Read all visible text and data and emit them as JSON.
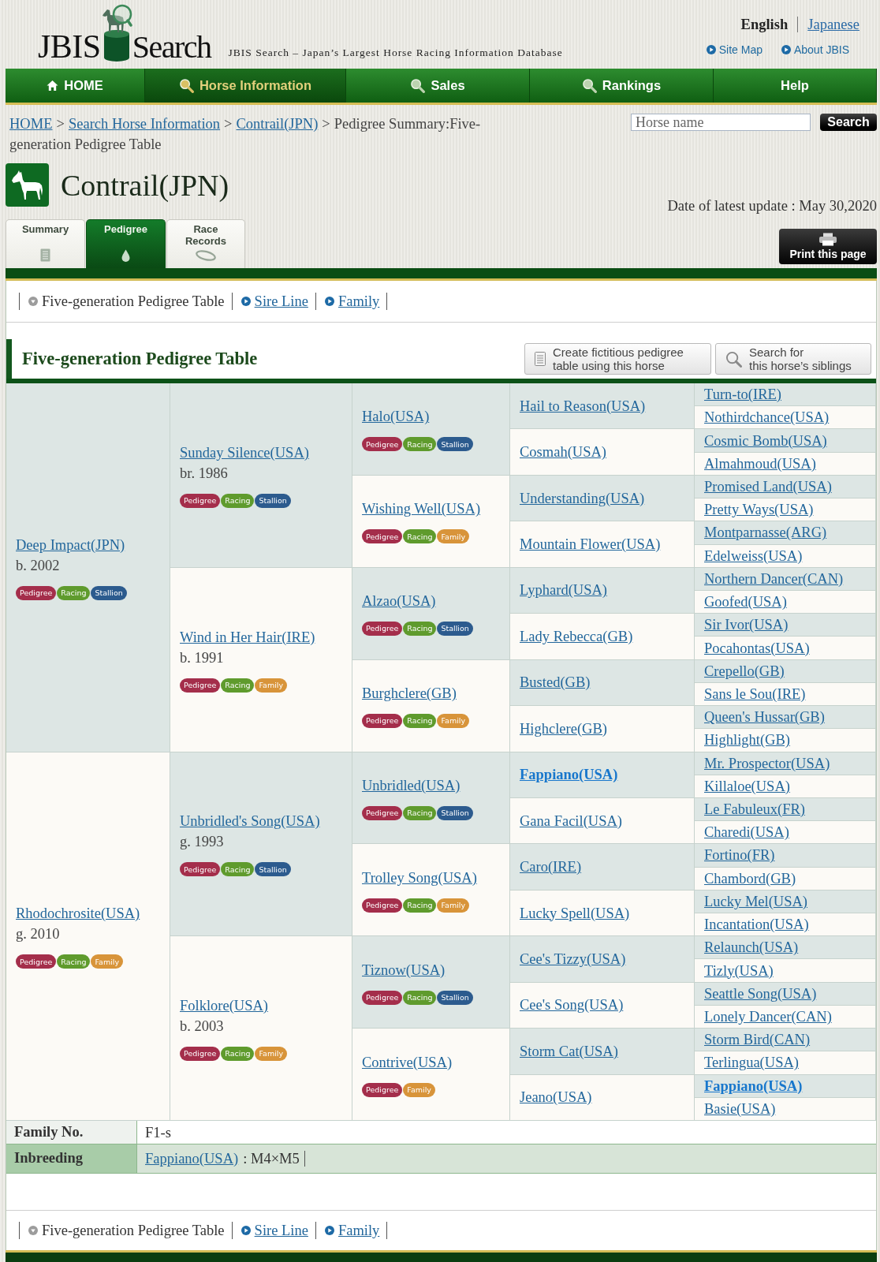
{
  "header": {
    "logo": {
      "before": "JBIS",
      "after": "Search"
    },
    "tagline": "JBIS Search – Japan’s Largest Horse Racing Information Database",
    "languages": [
      {
        "label": "English",
        "selected": true
      },
      {
        "label": "Japanese",
        "selected": false
      }
    ],
    "links": [
      "Site Map",
      "About JBIS"
    ]
  },
  "nav": [
    {
      "label": "HOME",
      "kind": "home",
      "selected": false
    },
    {
      "label": "Horse Information",
      "kind": "search",
      "selected": true
    },
    {
      "label": "Sales",
      "kind": "search",
      "selected": false
    },
    {
      "label": "Rankings",
      "kind": "search",
      "selected": false
    },
    {
      "label": "Help",
      "kind": "plain",
      "selected": false
    }
  ],
  "breadcrumb": [
    {
      "kind": "link",
      "label": "HOME"
    },
    {
      "kind": "separator",
      "label": ">"
    },
    {
      "kind": "link",
      "label": "Search Horse Information"
    },
    {
      "kind": "separator",
      "label": ">"
    },
    {
      "kind": "link",
      "label": "Contrail(JPN)"
    },
    {
      "kind": "separator",
      "label": ">"
    },
    {
      "kind": "text",
      "label": "Pedigree Summary:Five-generation Pedigree Table"
    }
  ],
  "search": {
    "placeholder": "Horse name",
    "button": "Search"
  },
  "horse": {
    "title": "Contrail(JPN)",
    "updated": "Date of latest update : May 30,2020"
  },
  "tabs": [
    {
      "label": "Summary",
      "kind": "document",
      "selected": false
    },
    {
      "label": "Pedigree",
      "kind": "drop",
      "selected": true
    },
    {
      "label": "Race Records",
      "kind": "track",
      "selected": false
    }
  ],
  "print_button": "Print this page",
  "subnav_top": [
    {
      "label": "Five-generation Pedigree Table",
      "selected": true
    },
    {
      "label": "Sire Line",
      "selected": false
    },
    {
      "label": "Family",
      "selected": false
    }
  ],
  "section": {
    "title": "Five-generation Pedigree Table",
    "buttons": [
      {
        "kind": "document",
        "lines": [
          "Create fictitious pedigree",
          "table using this horse"
        ]
      },
      {
        "kind": "search",
        "lines": [
          "Search for",
          "this horse’s siblings"
        ]
      }
    ]
  },
  "pedigree": [
    {
      "name": "Deep Impact(JPN)",
      "year": "b. 2002",
      "inbred": false,
      "badges": [
        {
          "label": "Pedigree",
          "color": "#a42e4b"
        },
        {
          "label": "Racing",
          "color": "#5f9b2d"
        },
        {
          "label": "Stallion",
          "color": "#2c5b8e"
        }
      ],
      "children": [
        {
          "name": "Sunday Silence(USA)",
          "year": "br. 1986",
          "inbred": false,
          "badges": [
            {
              "label": "Pedigree",
              "color": "#a42e4b"
            },
            {
              "label": "Racing",
              "color": "#5f9b2d"
            },
            {
              "label": "Stallion",
              "color": "#2c5b8e"
            }
          ],
          "children": [
            {
              "name": "Halo(USA)",
              "inbred": false,
              "badges": [
                {
                  "label": "Pedigree",
                  "color": "#a42e4b"
                },
                {
                  "label": "Racing",
                  "color": "#5f9b2d"
                },
                {
                  "label": "Stallion",
                  "color": "#2c5b8e"
                }
              ],
              "children": [
                {
                  "name": "Hail to Reason(USA)",
                  "inbred": false,
                  "children": [
                    {
                      "name": "Turn-to(IRE)",
                      "inbred": false
                    },
                    {
                      "name": "Nothirdchance(USA)",
                      "inbred": false
                    }
                  ]
                },
                {
                  "name": "Cosmah(USA)",
                  "inbred": false,
                  "children": [
                    {
                      "name": "Cosmic Bomb(USA)",
                      "inbred": false
                    },
                    {
                      "name": "Almahmoud(USA)",
                      "inbred": false
                    }
                  ]
                }
              ]
            },
            {
              "name": "Wishing Well(USA)",
              "inbred": false,
              "badges": [
                {
                  "label": "Pedigree",
                  "color": "#a42e4b"
                },
                {
                  "label": "Racing",
                  "color": "#5f9b2d"
                },
                {
                  "label": "Family",
                  "color": "#d8943a"
                }
              ],
              "children": [
                {
                  "name": "Understanding(USA)",
                  "inbred": false,
                  "children": [
                    {
                      "name": "Promised Land(USA)",
                      "inbred": false
                    },
                    {
                      "name": "Pretty Ways(USA)",
                      "inbred": false
                    }
                  ]
                },
                {
                  "name": "Mountain Flower(USA)",
                  "inbred": false,
                  "children": [
                    {
                      "name": "Montparnasse(ARG)",
                      "inbred": false
                    },
                    {
                      "name": "Edelweiss(USA)",
                      "inbred": false
                    }
                  ]
                }
              ]
            }
          ]
        },
        {
          "name": "Wind in Her Hair(IRE)",
          "year": "b. 1991",
          "inbred": false,
          "badges": [
            {
              "label": "Pedigree",
              "color": "#a42e4b"
            },
            {
              "label": "Racing",
              "color": "#5f9b2d"
            },
            {
              "label": "Family",
              "color": "#d8943a"
            }
          ],
          "children": [
            {
              "name": "Alzao(USA)",
              "inbred": false,
              "badges": [
                {
                  "label": "Pedigree",
                  "color": "#a42e4b"
                },
                {
                  "label": "Racing",
                  "color": "#5f9b2d"
                },
                {
                  "label": "Stallion",
                  "color": "#2c5b8e"
                }
              ],
              "children": [
                {
                  "name": "Lyphard(USA)",
                  "inbred": false,
                  "children": [
                    {
                      "name": "Northern Dancer(CAN)",
                      "inbred": false
                    },
                    {
                      "name": "Goofed(USA)",
                      "inbred": false
                    }
                  ]
                },
                {
                  "name": "Lady Rebecca(GB)",
                  "inbred": false,
                  "children": [
                    {
                      "name": "Sir Ivor(USA)",
                      "inbred": false
                    },
                    {
                      "name": "Pocahontas(USA)",
                      "inbred": false
                    }
                  ]
                }
              ]
            },
            {
              "name": "Burghclere(GB)",
              "inbred": false,
              "badges": [
                {
                  "label": "Pedigree",
                  "color": "#a42e4b"
                },
                {
                  "label": "Racing",
                  "color": "#5f9b2d"
                },
                {
                  "label": "Family",
                  "color": "#d8943a"
                }
              ],
              "children": [
                {
                  "name": "Busted(GB)",
                  "inbred": false,
                  "children": [
                    {
                      "name": "Crepello(GB)",
                      "inbred": false
                    },
                    {
                      "name": "Sans le Sou(IRE)",
                      "inbred": false
                    }
                  ]
                },
                {
                  "name": "Highclere(GB)",
                  "inbred": false,
                  "children": [
                    {
                      "name": "Queen's Hussar(GB)",
                      "inbred": false
                    },
                    {
                      "name": "Highlight(GB)",
                      "inbred": false
                    }
                  ]
                }
              ]
            }
          ]
        }
      ]
    },
    {
      "name": "Rhodochrosite(USA)",
      "year": "g. 2010",
      "inbred": false,
      "badges": [
        {
          "label": "Pedigree",
          "color": "#a42e4b"
        },
        {
          "label": "Racing",
          "color": "#5f9b2d"
        },
        {
          "label": "Family",
          "color": "#d8943a"
        }
      ],
      "children": [
        {
          "name": "Unbridled's Song(USA)",
          "year": "g. 1993",
          "inbred": false,
          "badges": [
            {
              "label": "Pedigree",
              "color": "#a42e4b"
            },
            {
              "label": "Racing",
              "color": "#5f9b2d"
            },
            {
              "label": "Stallion",
              "color": "#2c5b8e"
            }
          ],
          "children": [
            {
              "name": "Unbridled(USA)",
              "inbred": false,
              "badges": [
                {
                  "label": "Pedigree",
                  "color": "#a42e4b"
                },
                {
                  "label": "Racing",
                  "color": "#5f9b2d"
                },
                {
                  "label": "Stallion",
                  "color": "#2c5b8e"
                }
              ],
              "children": [
                {
                  "name": "Fappiano(USA)",
                  "inbred": true,
                  "children": [
                    {
                      "name": "Mr. Prospector(USA)",
                      "inbred": false
                    },
                    {
                      "name": "Killaloe(USA)",
                      "inbred": false
                    }
                  ]
                },
                {
                  "name": "Gana Facil(USA)",
                  "inbred": false,
                  "children": [
                    {
                      "name": "Le Fabuleux(FR)",
                      "inbred": false
                    },
                    {
                      "name": "Charedi(USA)",
                      "inbred": false
                    }
                  ]
                }
              ]
            },
            {
              "name": "Trolley Song(USA)",
              "inbred": false,
              "badges": [
                {
                  "label": "Pedigree",
                  "color": "#a42e4b"
                },
                {
                  "label": "Racing",
                  "color": "#5f9b2d"
                },
                {
                  "label": "Family",
                  "color": "#d8943a"
                }
              ],
              "children": [
                {
                  "name": "Caro(IRE)",
                  "inbred": false,
                  "children": [
                    {
                      "name": "Fortino(FR)",
                      "inbred": false
                    },
                    {
                      "name": "Chambord(GB)",
                      "inbred": false
                    }
                  ]
                },
                {
                  "name": "Lucky Spell(USA)",
                  "inbred": false,
                  "children": [
                    {
                      "name": "Lucky Mel(USA)",
                      "inbred": false
                    },
                    {
                      "name": "Incantation(USA)",
                      "inbred": false
                    }
                  ]
                }
              ]
            }
          ]
        },
        {
          "name": "Folklore(USA)",
          "year": "b. 2003",
          "inbred": false,
          "badges": [
            {
              "label": "Pedigree",
              "color": "#a42e4b"
            },
            {
              "label": "Racing",
              "color": "#5f9b2d"
            },
            {
              "label": "Family",
              "color": "#d8943a"
            }
          ],
          "children": [
            {
              "name": "Tiznow(USA)",
              "inbred": false,
              "badges": [
                {
                  "label": "Pedigree",
                  "color": "#a42e4b"
                },
                {
                  "label": "Racing",
                  "color": "#5f9b2d"
                },
                {
                  "label": "Stallion",
                  "color": "#2c5b8e"
                }
              ],
              "children": [
                {
                  "name": "Cee's Tizzy(USA)",
                  "inbred": false,
                  "children": [
                    {
                      "name": "Relaunch(USA)",
                      "inbred": false
                    },
                    {
                      "name": "Tizly(USA)",
                      "inbred": false
                    }
                  ]
                },
                {
                  "name": "Cee's Song(USA)",
                  "inbred": false,
                  "children": [
                    {
                      "name": "Seattle Song(USA)",
                      "inbred": false
                    },
                    {
                      "name": "Lonely Dancer(CAN)",
                      "inbred": false
                    }
                  ]
                }
              ]
            },
            {
              "name": "Contrive(USA)",
              "inbred": false,
              "badges": [
                {
                  "label": "Pedigree",
                  "color": "#a42e4b"
                },
                {
                  "label": "Family",
                  "color": "#d8943a"
                }
              ],
              "children": [
                {
                  "name": "Storm Cat(USA)",
                  "inbred": false,
                  "children": [
                    {
                      "name": "Storm Bird(CAN)",
                      "inbred": false
                    },
                    {
                      "name": "Terlingua(USA)",
                      "inbred": false
                    }
                  ]
                },
                {
                  "name": "Jeano(USA)",
                  "inbred": false,
                  "children": [
                    {
                      "name": "Fappiano(USA)",
                      "inbred": true
                    },
                    {
                      "name": "Basie(USA)",
                      "inbred": false
                    }
                  ]
                }
              ]
            }
          ]
        }
      ]
    }
  ],
  "details": [
    {
      "kind": "family",
      "label": "Family No.",
      "value": "F1-s"
    },
    {
      "kind": "inbreeding",
      "label": "Inbreeding",
      "link": "Fappiano(USA)",
      "value": ": M4×M5"
    }
  ],
  "subnav_bottom": [
    {
      "label": "Five-generation Pedigree Table",
      "selected": true
    },
    {
      "label": "Sire Line",
      "selected": false
    },
    {
      "label": "Family",
      "selected": false
    }
  ]
}
